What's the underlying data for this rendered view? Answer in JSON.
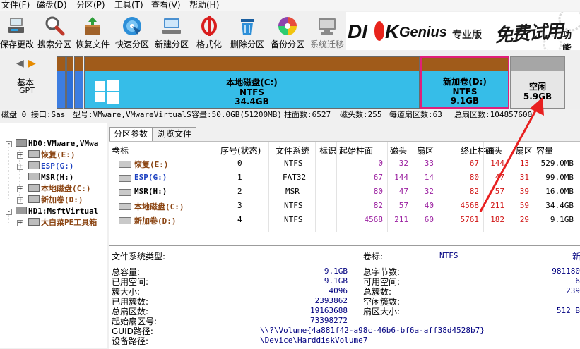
{
  "menu": [
    "文件(F)",
    "磁盘(D)",
    "分区(P)",
    "工具(T)",
    "查看(V)",
    "帮助(H)"
  ],
  "toolbar": [
    {
      "label": "保存更改",
      "icon": "save-icon",
      "enabled": true
    },
    {
      "label": "搜索分区",
      "icon": "magnifier-icon",
      "enabled": true
    },
    {
      "label": "恢复文件",
      "icon": "recover-box-icon",
      "enabled": true
    },
    {
      "label": "快速分区",
      "icon": "disc-icon",
      "enabled": true
    },
    {
      "label": "新建分区",
      "icon": "new-partition-icon",
      "enabled": true
    },
    {
      "label": "格式化",
      "icon": "format-icon",
      "enabled": true
    },
    {
      "label": "删除分区",
      "icon": "trash-icon",
      "enabled": true
    },
    {
      "label": "备份分区",
      "icon": "backup-icon",
      "enabled": true
    },
    {
      "label": "系统迁移",
      "icon": "migrate-icon",
      "enabled": false
    }
  ],
  "banner": {
    "brand1": "DI",
    "brand2": "K",
    "brand3": "Genius",
    "edition": "专业版",
    "promo": "免费试用",
    "more": "功能"
  },
  "disk_nav": {
    "line1": "基本",
    "line2": "GPT"
  },
  "disk_map": {
    "c": {
      "name": "本地磁盘(C:)",
      "fs": "NTFS",
      "size": "34.4GB"
    },
    "d": {
      "name": "新加卷(D:)",
      "fs": "NTFS",
      "size": "9.1GB"
    },
    "free": {
      "name": "空闲",
      "size": "5.9GB"
    }
  },
  "disk_info": {
    "disk": "磁盘 0 接口:Sas",
    "model": "型号:VMware,VMwareVirtualS",
    "capacity": "容量:50.0GB(51200MB)",
    "cylinders": "柱面数:6527",
    "heads": "磁头数:255",
    "sectors": "每道扇区数:63",
    "total": "总扇区数:104857600"
  },
  "tree": [
    {
      "label": "HD0:VMware,VMwa",
      "level": 0,
      "box": "-",
      "color": "#000000"
    },
    {
      "label": "恢复(E:)",
      "level": 1,
      "box": "+",
      "color": "#8b4513"
    },
    {
      "label": "ESP(G:)",
      "level": 1,
      "box": "+",
      "color": "#1a3fc0"
    },
    {
      "label": "MSR(H:)",
      "level": 1,
      "box": "",
      "color": "#000000"
    },
    {
      "label": "本地磁盘(C:)",
      "level": 1,
      "box": "+",
      "color": "#8b4513"
    },
    {
      "label": "新加卷(D:)",
      "level": 1,
      "box": "+",
      "color": "#8b4513"
    },
    {
      "label": "HD1:MsftVirtual",
      "level": 0,
      "box": "-",
      "color": "#000000"
    },
    {
      "label": "大白菜PE工具箱",
      "level": 1,
      "box": "+",
      "color": "#8b4513"
    }
  ],
  "tabs": [
    "分区参数",
    "浏览文件"
  ],
  "table": {
    "headers": [
      "卷标",
      "序号(状态)",
      "文件系统",
      "标识",
      "起始柱面",
      "磁头",
      "扇区",
      "终止柱面",
      "磁头",
      "扇区",
      "容量"
    ],
    "rows": [
      {
        "name": "恢复(E:)",
        "color": "#8b4513",
        "cells": [
          "0",
          "NTFS",
          "",
          "0",
          "32",
          "33",
          "67",
          "144",
          "13",
          "529.0MB"
        ]
      },
      {
        "name": "ESP(G:)",
        "color": "#1a3fc0",
        "cells": [
          "1",
          "FAT32",
          "",
          "67",
          "144",
          "14",
          "80",
          "47",
          "31",
          "99.0MB"
        ]
      },
      {
        "name": "MSR(H:)",
        "color": "#000000",
        "cells": [
          "2",
          "MSR",
          "",
          "80",
          "47",
          "32",
          "82",
          "57",
          "39",
          "16.0MB"
        ]
      },
      {
        "name": "本地磁盘(C:)",
        "color": "#8b4513",
        "cells": [
          "3",
          "NTFS",
          "",
          "82",
          "57",
          "40",
          "4568",
          "211",
          "59",
          "34.4GB"
        ]
      },
      {
        "name": "新加卷(D:)",
        "color": "#8b4513",
        "cells": [
          "4",
          "NTFS",
          "",
          "4568",
          "211",
          "60",
          "5761",
          "182",
          "29",
          "9.1GB"
        ]
      }
    ]
  },
  "details": {
    "fs_type_label": "文件系统类型:",
    "fs_type": "NTFS",
    "volume_label": "卷标:",
    "volume": "新",
    "left": [
      {
        "k": "总容量:",
        "v": "9.1GB"
      },
      {
        "k": "已用空间:",
        "v": "9.1GB"
      },
      {
        "k": "簇大小:",
        "v": "4096"
      },
      {
        "k": "已用簇数:",
        "v": "2393862"
      },
      {
        "k": "总扇区数:",
        "v": "19163688"
      },
      {
        "k": "起始扇区号:",
        "v": "73398272"
      }
    ],
    "right": [
      {
        "k": "总字节数:",
        "v": "981180"
      },
      {
        "k": "可用空间:",
        "v": "6"
      },
      {
        "k": "总簇数:",
        "v": "239"
      },
      {
        "k": "空闲簇数:",
        "v": ""
      },
      {
        "k": "扇区大小:",
        "v": "512 B"
      }
    ],
    "guid_label": "GUID路径:",
    "guid": "\\\\?\\Volume{4a881f42-a98c-46b6-bf6a-aff38d4528b7}",
    "device_label": "设备路径:",
    "device": "\\Device\\HarddiskVolume7"
  }
}
